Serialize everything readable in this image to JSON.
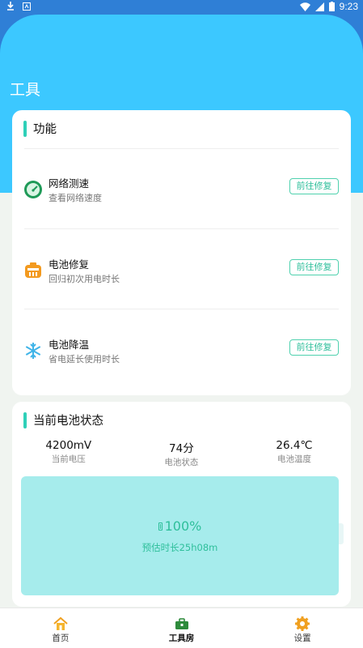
{
  "status_bar": {
    "time": "9:23",
    "icons": [
      "download-icon",
      "notification-icon",
      "wifi-icon",
      "signal-icon",
      "battery-icon"
    ]
  },
  "page": {
    "title": "工具"
  },
  "functions": {
    "title": "功能",
    "items": [
      {
        "icon": "speedometer-icon",
        "name": "网络测速",
        "desc": "查看网络速度",
        "button": "前往修复"
      },
      {
        "icon": "battery-repair-icon",
        "name": "电池修复",
        "desc": "回归初次用电时长",
        "button": "前往修复"
      },
      {
        "icon": "snowflake-icon",
        "name": "电池降温",
        "desc": "省电延长使用时长",
        "button": "前往修复"
      }
    ]
  },
  "battery": {
    "title": "当前电池状态",
    "stats": [
      {
        "value": "4200mV",
        "label": "当前电压"
      },
      {
        "value": "74分",
        "label": "电池状态"
      },
      {
        "value": "26.4℃",
        "label": "电池温度"
      }
    ],
    "percent": "100%",
    "level": 1.0,
    "estimate": "预估时长25h08m"
  },
  "tabbar": {
    "items": [
      {
        "label": "首页",
        "icon": "home-icon"
      },
      {
        "label": "工具房",
        "icon": "toolbox-icon",
        "active": true
      },
      {
        "label": "设置",
        "icon": "gear-icon"
      }
    ]
  },
  "colors": {
    "accent": "#2fd0b8",
    "header": "#3cc8ff",
    "battery_fill": "#a6ecec"
  }
}
